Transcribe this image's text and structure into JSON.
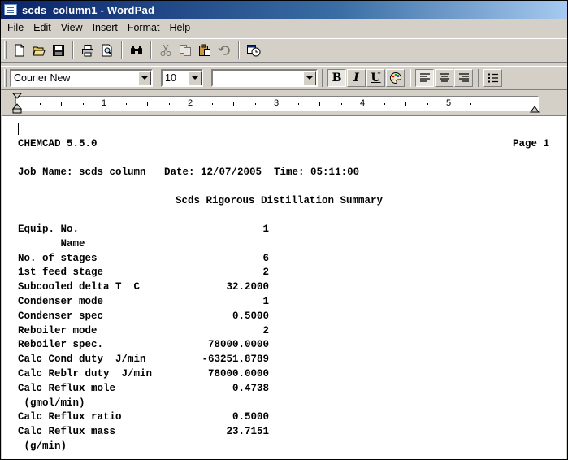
{
  "window": {
    "title": "scds_column1 - WordPad"
  },
  "menu": [
    "File",
    "Edit",
    "View",
    "Insert",
    "Format",
    "Help"
  ],
  "toolbar": {
    "buttons": [
      "new-icon",
      "open-icon",
      "save-icon",
      "print-icon",
      "print-preview-icon",
      "find-icon",
      "cut-icon",
      "copy-icon",
      "paste-icon",
      "undo-icon",
      "insert-date-time-icon"
    ]
  },
  "format_bar": {
    "font": "Courier New",
    "size": "10",
    "script": "",
    "bold": "B",
    "italic": "I",
    "underline": "U"
  },
  "ruler": {
    "numbers": [
      "1",
      "2",
      "3",
      "4",
      "5"
    ]
  },
  "document": {
    "header_left": "CHEMCAD 5.5.0",
    "header_right": "Page 1",
    "job_line": "Job Name: scds column   Date: 12/07/2005  Time: 05:11:00",
    "summary_title": "Scds Rigorous Distillation Summary",
    "rows": [
      {
        "label": "Equip. No.",
        "value": "1"
      },
      {
        "label": "       Name",
        "value": ""
      },
      {
        "label": "No. of stages",
        "value": "6"
      },
      {
        "label": "1st feed stage",
        "value": "2"
      },
      {
        "label": "Subcooled delta T  C",
        "value": "32.2000"
      },
      {
        "label": "Condenser mode",
        "value": "1"
      },
      {
        "label": "Condenser spec",
        "value": "0.5000"
      },
      {
        "label": "Reboiler mode",
        "value": "2"
      },
      {
        "label": "Reboiler spec.",
        "value": "78000.0000"
      },
      {
        "label": "Calc Cond duty  J/min",
        "value": "-63251.8789"
      },
      {
        "label": "Calc Reblr duty  J/min",
        "value": "78000.0000"
      },
      {
        "label": "Calc Reflux mole",
        "value": "0.4738"
      },
      {
        "label": " (gmol/min)",
        "value": ""
      },
      {
        "label": "Calc Reflux ratio",
        "value": "0.5000"
      },
      {
        "label": "Calc Reflux mass",
        "value": "23.7151"
      },
      {
        "label": " (g/min)",
        "value": ""
      }
    ]
  }
}
